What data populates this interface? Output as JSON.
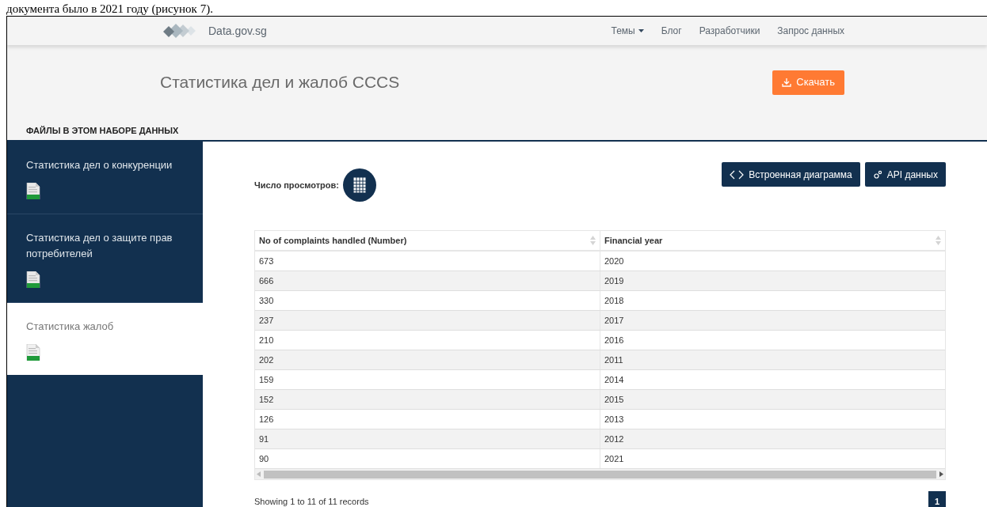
{
  "caption": "документа было в 2021 году (рисунок 7).",
  "navbar": {
    "brand": "Data.gov.sg",
    "links": [
      {
        "label": "Темы",
        "dropdown": true
      },
      {
        "label": "Блог",
        "dropdown": false
      },
      {
        "label": "Разработчики",
        "dropdown": false
      },
      {
        "label": "Запрос данных",
        "dropdown": false
      }
    ]
  },
  "header": {
    "title": "Статистика дел и жалоб CCCS",
    "download_button": "Скачать",
    "files_heading": "ФАЙЛЫ В ЭТОМ НАБОРЕ ДАННЫХ"
  },
  "sidebar": {
    "items": [
      {
        "label": "Статистика дел о конкуренции",
        "selected": false
      },
      {
        "label": "Статистика дел о защите прав потребителей",
        "selected": false
      },
      {
        "label": "Статистика жалоб",
        "selected": true
      }
    ]
  },
  "toolbar": {
    "views_label": "Число просмотров:",
    "buttons": [
      {
        "kind": "embed",
        "label": "Встроенная диаграмма"
      },
      {
        "kind": "api",
        "label": "API данных"
      }
    ]
  },
  "table": {
    "columns": [
      "No of complaints handled (Number)",
      "Financial year"
    ],
    "rows": [
      [
        "673",
        "2020"
      ],
      [
        "666",
        "2019"
      ],
      [
        "330",
        "2018"
      ],
      [
        "237",
        "2017"
      ],
      [
        "210",
        "2016"
      ],
      [
        "202",
        "2011"
      ],
      [
        "159",
        "2014"
      ],
      [
        "152",
        "2015"
      ],
      [
        "126",
        "2013"
      ],
      [
        "91",
        "2012"
      ],
      [
        "90",
        "2021"
      ]
    ]
  },
  "footer": {
    "info": "Showing 1 to 11 of 11 records",
    "pages": [
      {
        "label": "1",
        "selected": true
      }
    ]
  }
}
